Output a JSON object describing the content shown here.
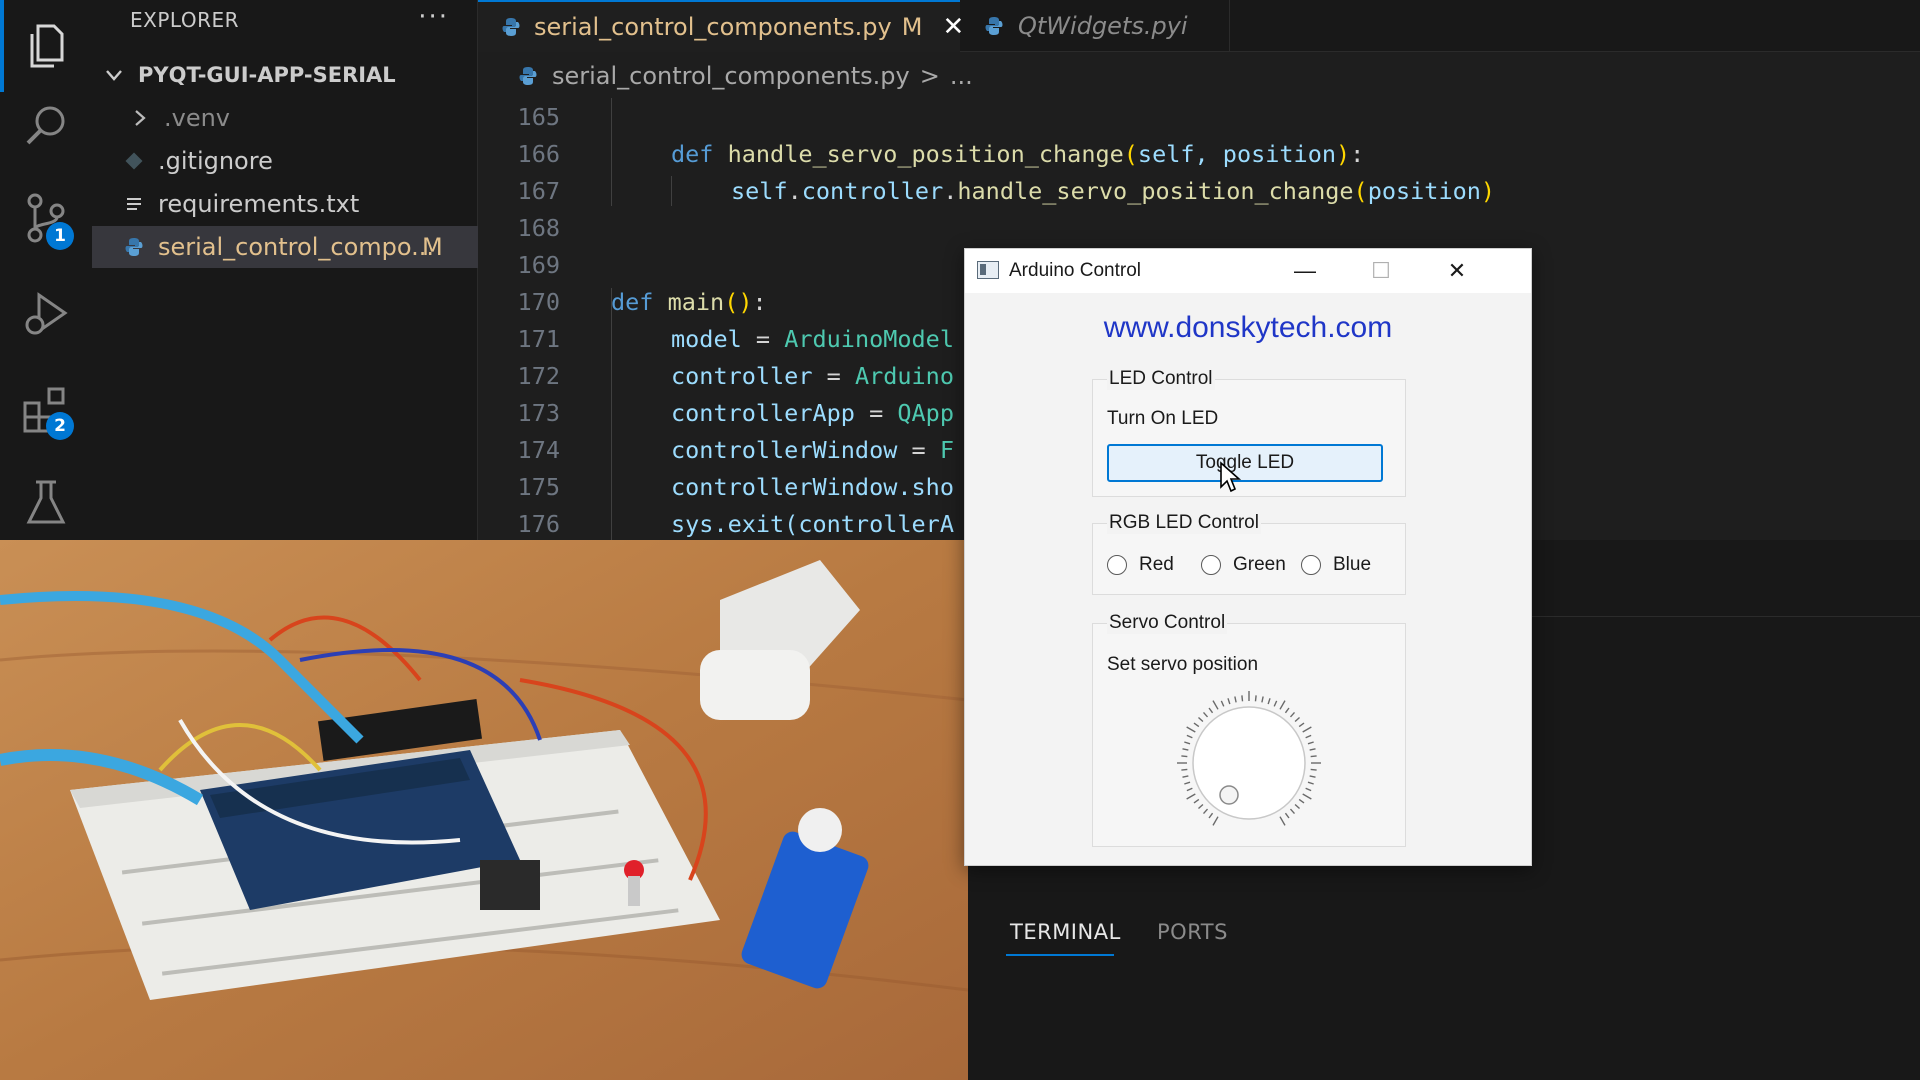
{
  "activity_bar": {
    "source_control_badge": "1",
    "extensions_badge": "2"
  },
  "explorer": {
    "title": "EXPLORER",
    "more": "···",
    "root": "PYQT-GUI-APP-SERIAL",
    "items": [
      {
        "label": ".venv",
        "kind": "folder"
      },
      {
        "label": ".gitignore",
        "kind": "git"
      },
      {
        "label": "requirements.txt",
        "kind": "text"
      },
      {
        "label": "serial_control_compo...",
        "kind": "python",
        "status": "M"
      }
    ]
  },
  "tabs": [
    {
      "label": "serial_control_components.py",
      "status": "M",
      "close": "✕"
    },
    {
      "label": "QtWidgets.pyi"
    }
  ],
  "breadcrumb": {
    "file": "serial_control_components.py",
    "sep": ">",
    "rest": "..."
  },
  "code": {
    "line_numbers": [
      "165",
      "166",
      "167",
      "168",
      "169",
      "170",
      "171",
      "172",
      "173",
      "174",
      "175",
      "176"
    ],
    "l166_kw": "def",
    "l166_fn": "handle_servo_position_change",
    "l166_args": "self, position",
    "l167_self": "self",
    "l167_attr": "controller",
    "l167_fn": "handle_servo_position_change",
    "l167_arg": "position",
    "l170_kw": "def",
    "l170_fn": "main",
    "l171_var": "model",
    "l171_cls": "ArduinoModel",
    "l172_var": "controller",
    "l172_cls": "Arduino",
    "l173_var": "controllerApp",
    "l173_cls": "QApp",
    "l174_var": "controllerWindow",
    "l174_cls": "F",
    "l175_text": "controllerWindow.sho",
    "l176_text": "sys.exit(controllerA"
  },
  "panel": {
    "tabs": [
      "TERMINAL",
      "PORTS"
    ],
    "active": "TERMINAL"
  },
  "qt_window": {
    "title": "Arduino Control",
    "minimize": "—",
    "maximize": "☐",
    "close": "✕",
    "link": "www.donskytech.com",
    "led_group": {
      "title": "LED Control",
      "label": "Turn On LED",
      "button": "Toggle LED"
    },
    "rgb_group": {
      "title": "RGB LED Control",
      "options": [
        "Red",
        "Green",
        "Blue"
      ]
    },
    "servo_group": {
      "title": "Servo Control",
      "label": "Set servo position",
      "dial_value": 0
    }
  },
  "colors": {
    "accent": "#0078d4",
    "modified": "#e2c08d",
    "link": "#1f36c7"
  }
}
